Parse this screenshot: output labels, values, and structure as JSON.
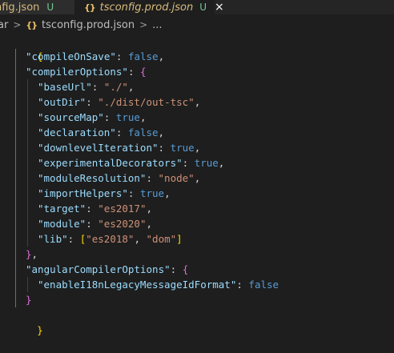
{
  "tabs": [
    {
      "label": "nfig.json",
      "badge": "U",
      "active": false
    },
    {
      "label": "tsconfig.prod.json",
      "badge": "U",
      "active": true,
      "close_icon": "×"
    }
  ],
  "breadcrumb": {
    "segments": [
      "ar",
      "tsconfig.prod.json",
      "..."
    ],
    "file_icon": "{}"
  },
  "code": {
    "open_brace": "{",
    "close_brace": "}",
    "compileOnSave": {
      "key": "\"compileOnSave\"",
      "value": "false"
    },
    "compilerOptions_key": "\"compilerOptions\"",
    "compilerOptions": [
      {
        "key": "\"baseUrl\"",
        "value": "\"./\"",
        "type": "string"
      },
      {
        "key": "\"outDir\"",
        "value": "\"./dist/out-tsc\"",
        "type": "string"
      },
      {
        "key": "\"sourceMap\"",
        "value": "true",
        "type": "bool"
      },
      {
        "key": "\"declaration\"",
        "value": "false",
        "type": "bool"
      },
      {
        "key": "\"downlevelIteration\"",
        "value": "true",
        "type": "bool"
      },
      {
        "key": "\"experimentalDecorators\"",
        "value": "true",
        "type": "bool"
      },
      {
        "key": "\"moduleResolution\"",
        "value": "\"node\"",
        "type": "string"
      },
      {
        "key": "\"importHelpers\"",
        "value": "true",
        "type": "bool"
      },
      {
        "key": "\"target\"",
        "value": "\"es2017\"",
        "type": "string"
      },
      {
        "key": "\"module\"",
        "value": "\"es2020\"",
        "type": "string"
      }
    ],
    "lib": {
      "key": "\"lib\"",
      "values": [
        "\"es2018\"",
        "\"dom\""
      ]
    },
    "angularCompilerOptions_key": "\"angularCompilerOptions\"",
    "enableI18n": {
      "key": "\"enableI18nLegacyMessageIdFormat\"",
      "value": "false"
    }
  },
  "colors": {
    "background": "#1e1e1e",
    "key": "#9cdcfe",
    "string": "#ce9178",
    "boolean": "#569cd6",
    "bracket_level1": "#ffd700",
    "bracket_level2": "#da70d6",
    "untracked_badge": "#73c991"
  }
}
